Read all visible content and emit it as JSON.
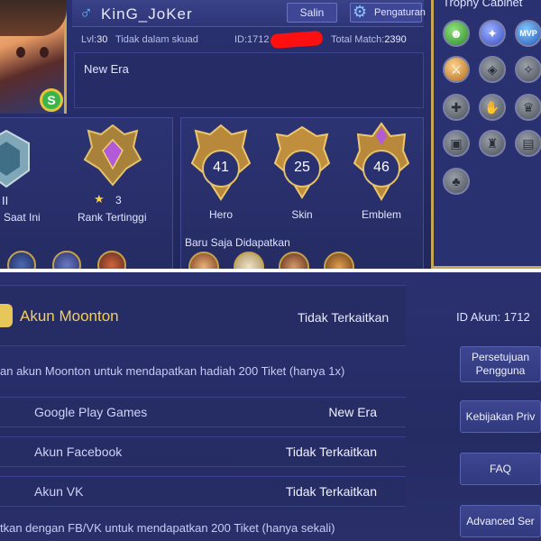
{
  "profile": {
    "name": "KinG_JoKer",
    "gender_icon": "male-icon",
    "copy_button": "Salin",
    "settings_button": "Pengaturan",
    "level_label": "Lvl:",
    "level_value": "30",
    "squad_status": "Tidak dalam skuad",
    "id_prefix": "ID:1712",
    "total_match_label": "Total Match:",
    "total_match_value": "2390",
    "bio": "New Era"
  },
  "rank": {
    "current_label": "Saat Ini",
    "current_numeral": "II",
    "highest_label": "Rank Tertinggi",
    "highest_stars": "3"
  },
  "stats": [
    {
      "label": "Hero",
      "value": "41"
    },
    {
      "label": "Skin",
      "value": "25"
    },
    {
      "label": "Emblem",
      "value": "46"
    }
  ],
  "recent": {
    "title": "Baru Saja Didapatkan"
  },
  "trophy_cabinet": {
    "title": "Trophy Cabinet",
    "items": [
      "friends-icon",
      "wings-icon",
      "MVP",
      "sword-icon",
      "shield-icon",
      "rune-icon",
      "cross-icon",
      "hand-icon",
      "crown-icon",
      "chest-icon",
      "cup-icon",
      "book-icon",
      "tree-icon"
    ]
  },
  "account": {
    "moonton_label": "Akun Moonton",
    "moonton_status": "Tidak Terkaitkan",
    "moonton_bonus_text": "an akun Moonton untuk mendapatkan hadiah 200 Tiket (hanya 1x)",
    "bindings": [
      {
        "label": "Google Play Games",
        "status": "New Era"
      },
      {
        "label": "Akun Facebook",
        "status": "Tidak Terkaitkan"
      },
      {
        "label": "Akun VK",
        "status": "Tidak Terkaitkan"
      }
    ],
    "fb_vk_bonus_text": "tkan dengan FB/VK untuk mendapatkan 200 Tiket (hanya sekali)",
    "id_label": "ID Akun: 1712",
    "side_buttons": [
      "Persetujuan Pengguna",
      "Kebijakan Priv",
      "FAQ",
      "Advanced Ser"
    ]
  }
}
